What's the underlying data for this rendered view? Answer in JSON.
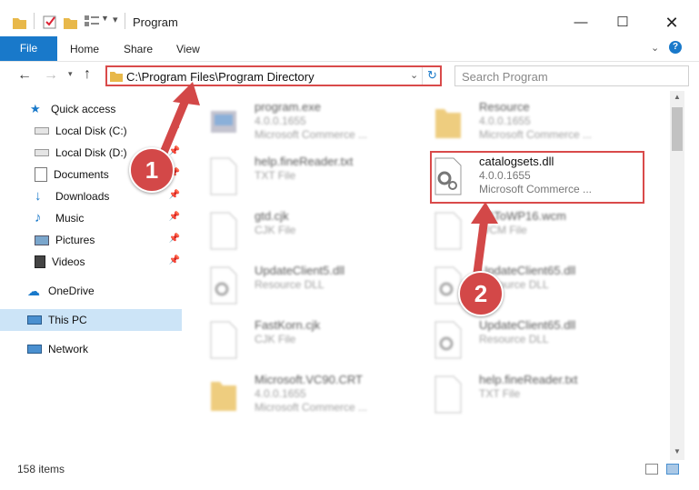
{
  "window": {
    "title": "Program"
  },
  "ribbon": {
    "tabs": [
      "File",
      "Home",
      "Share",
      "View"
    ]
  },
  "address": {
    "path": "C:\\Program Files\\Program Directory",
    "search_placeholder": "Search Program"
  },
  "sidebar": {
    "items": [
      {
        "label": "Quick access",
        "icon": "star-icon"
      },
      {
        "label": "Local Disk (C:)",
        "icon": "drive-icon"
      },
      {
        "label": "Local Disk (D:)",
        "icon": "drive-icon"
      },
      {
        "label": "Documents",
        "icon": "documents-icon"
      },
      {
        "label": "Downloads",
        "icon": "download-icon"
      },
      {
        "label": "Music",
        "icon": "music-icon"
      },
      {
        "label": "Pictures",
        "icon": "pictures-icon"
      },
      {
        "label": "Videos",
        "icon": "videos-icon"
      },
      {
        "label": "OneDrive",
        "icon": "cloud-icon"
      },
      {
        "label": "This PC",
        "icon": "pc-icon"
      },
      {
        "label": "Network",
        "icon": "network-icon"
      }
    ]
  },
  "files": [
    {
      "name": "program.exe",
      "l1": "4.0.0.1655",
      "l2": "Microsoft Commerce ..."
    },
    {
      "name": "Resource",
      "l1": "4.0.0.1655",
      "l2": "Microsoft Commerce ..."
    },
    {
      "name": "help.fineReader.txt",
      "l1": "TXT File",
      "l2": ""
    },
    {
      "name": "catalogsets.dll",
      "l1": "4.0.0.1655",
      "l2": "Microsoft Commerce ..."
    },
    {
      "name": "gtd.cjk",
      "l1": "CJK File",
      "l2": ""
    },
    {
      "name": "SAToWP16.wcm",
      "l1": "WCM File",
      "l2": ""
    },
    {
      "name": "UpdateClient5.dll",
      "l1": "Resource DLL",
      "l2": ""
    },
    {
      "name": "UpdateClient65.dll",
      "l1": "Resource DLL",
      "l2": ""
    },
    {
      "name": "FastKorn.cjk",
      "l1": "CJK File",
      "l2": ""
    },
    {
      "name": "UpdateClient65.dll",
      "l1": "Resource DLL",
      "l2": ""
    },
    {
      "name": "Microsoft.VC90.CRT",
      "l1": "4.0.0.1655",
      "l2": "Microsoft Commerce ..."
    },
    {
      "name": "help.fineReader.txt",
      "l1": "TXT File",
      "l2": ""
    }
  ],
  "status": {
    "count": "158 items"
  },
  "callouts": [
    "1",
    "2"
  ],
  "colors": {
    "accent": "#1979ca",
    "highlight": "#d94a4a"
  }
}
